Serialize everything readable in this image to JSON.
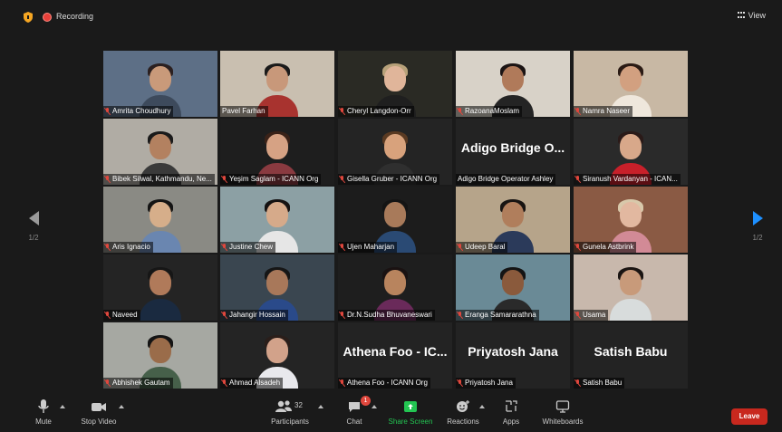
{
  "top_bar": {
    "recording_label": "Recording",
    "view_label": "View"
  },
  "pager": {
    "left_page": "1/2",
    "right_page": "1/2"
  },
  "participants": [
    {
      "name": "Amrita Choudhury",
      "muted": true,
      "video": true,
      "bg": "#5d6f86",
      "skin": "#c99a7a",
      "hair": "#2b2020",
      "shirt": "#3d4a5c"
    },
    {
      "name": "Pavel Farhan",
      "muted": false,
      "video": true,
      "speaking": true,
      "bg": "#c9bfb0",
      "skin": "#c8987a",
      "hair": "#1a1a1a",
      "shirt": "#a8332f"
    },
    {
      "name": "Cheryl Langdon-Orr",
      "muted": true,
      "video": true,
      "bg": "#2a2a24",
      "skin": "#e0b59a",
      "hair": "#b8a27a",
      "shirt": "#1f1f1f"
    },
    {
      "name": "RazoanaMoslam",
      "muted": true,
      "video": true,
      "bg": "#d8d2c8",
      "skin": "#b07a5a",
      "hair": "#1b1414",
      "shirt": "#242424"
    },
    {
      "name": "Namra Naseer",
      "muted": true,
      "video": true,
      "bg": "#c8b8a4",
      "skin": "#d2a080",
      "hair": "#2a1a14",
      "shirt": "#efe7dc"
    },
    {
      "name": "Bibek Silwal, Kathmandu, Ne...",
      "muted": true,
      "video": true,
      "bg": "#b0aca4",
      "skin": "#b38160",
      "hair": "#1a1a1a",
      "shirt": "#3a3a3a"
    },
    {
      "name": "Yeşim Saglam - ICANN Org",
      "muted": true,
      "video": true,
      "bg": "#1e1e1e",
      "skin": "#d6a284",
      "hair": "#3a2218",
      "shirt": "#8a3a40"
    },
    {
      "name": "Gisella Gruber - ICANN Org",
      "muted": true,
      "video": true,
      "bg": "#242424",
      "skin": "#d8a27c",
      "hair": "#5a3a22",
      "shirt": "#2f2f2f"
    },
    {
      "name": "Adigo Bridge Operator Ashley",
      "muted": false,
      "video": false,
      "big_label": "Adigo Bridge O..."
    },
    {
      "name": "Siranush Vardanyan - ICAN...",
      "muted": true,
      "video": true,
      "bg": "#2a2a2a",
      "skin": "#d8a88a",
      "hair": "#2a1a18",
      "shirt": "#c8202a"
    },
    {
      "name": "Aris Ignacio",
      "muted": true,
      "video": true,
      "bg": "#8a8a84",
      "skin": "#d6ae8a",
      "hair": "#141414",
      "shirt": "#6a86b0"
    },
    {
      "name": "Justine Chew",
      "muted": true,
      "video": true,
      "bg": "#8ca0a4",
      "skin": "#d6aa8a",
      "hair": "#151212",
      "shirt": "#e6e6e6"
    },
    {
      "name": "Ujen Maharjan",
      "muted": true,
      "video": true,
      "bg": "#1c1c1c",
      "skin": "#a87a5a",
      "hair": "#141414",
      "shirt": "#2a4a74"
    },
    {
      "name": "Udeep Baral",
      "muted": true,
      "video": true,
      "bg": "#b6a48a",
      "skin": "#b07e5c",
      "hair": "#181412",
      "shirt": "#2b3a5a"
    },
    {
      "name": "Gunela Astbrink",
      "muted": true,
      "video": true,
      "bg": "#8a5a44",
      "skin": "#e2b8a0",
      "hair": "#d8c8aa",
      "shirt": "#d28a96"
    },
    {
      "name": "Naveed",
      "muted": true,
      "video": true,
      "bg": "#242424",
      "skin": "#b07a5a",
      "hair": "#161616",
      "shirt": "#1a2a40"
    },
    {
      "name": "Jahangir Hossain",
      "muted": true,
      "video": true,
      "bg": "#3a4650",
      "skin": "#a8785a",
      "hair": "#161616",
      "shirt": "#2a4a8a"
    },
    {
      "name": "Dr.N.Sudha Bhuvaneswari",
      "muted": true,
      "video": true,
      "bg": "#1e1e1e",
      "skin": "#b8845e",
      "hair": "#1a1212",
      "shirt": "#6a2a5a"
    },
    {
      "name": "Eranga Samararathna",
      "muted": true,
      "video": true,
      "bg": "#6a8a96",
      "skin": "#8a5a3c",
      "hair": "#141414",
      "shirt": "#2a2a2a"
    },
    {
      "name": "Usama",
      "muted": true,
      "video": true,
      "bg": "#c8b8ac",
      "skin": "#c89a7a",
      "hair": "#1a1412",
      "shirt": "#d8dcdc"
    },
    {
      "name": "Abhishek Gautam",
      "muted": true,
      "video": true,
      "bg": "#a6a8a2",
      "skin": "#9a6c4a",
      "hair": "#141414",
      "shirt": "#46604a"
    },
    {
      "name": "Ahmad Alsadeh",
      "muted": true,
      "video": true,
      "bg": "#242424",
      "skin": "#d2a28a",
      "hair": "#2a1e1a",
      "shirt": "#e8e8ec"
    },
    {
      "name": "Athena Foo - ICANN Org",
      "muted": true,
      "video": false,
      "big_label": "Athena Foo - IC..."
    },
    {
      "name": "Priyatosh Jana",
      "muted": true,
      "video": false,
      "big_label": "Priyatosh Jana"
    },
    {
      "name": "Satish Babu",
      "muted": true,
      "video": false,
      "big_label": "Satish Babu"
    }
  ],
  "toolbar": {
    "mute_label": "Mute",
    "stop_video_label": "Stop Video",
    "participants_label": "Participants",
    "participants_count": "32",
    "chat_label": "Chat",
    "chat_badge": "1",
    "share_screen_label": "Share Screen",
    "reactions_label": "Reactions",
    "apps_label": "Apps",
    "whiteboards_label": "Whiteboards",
    "leave_label": "Leave"
  },
  "colors": {
    "share_green": "#23c552",
    "leave_red": "#c8281e",
    "pager_blue": "#1e90ff",
    "speaking_outline": "#c6e04a"
  }
}
